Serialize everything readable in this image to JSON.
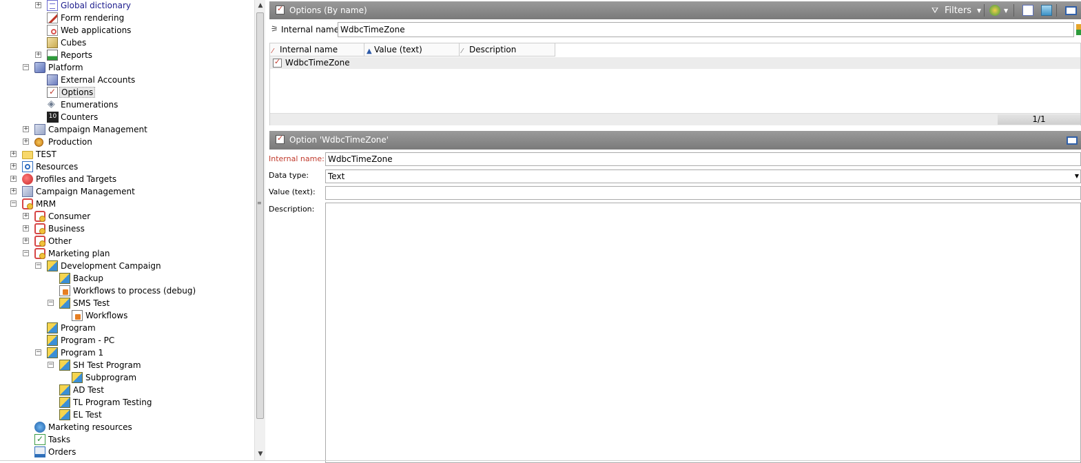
{
  "tree": {
    "items": [
      {
        "label": "Global dictionary",
        "icon": "dictionary-icon",
        "expander": "plus"
      },
      {
        "label": "Form rendering",
        "icon": "form-rendering-icon"
      },
      {
        "label": "Web applications",
        "icon": "web-applications-icon"
      },
      {
        "label": "Cubes",
        "icon": "cube-icon"
      },
      {
        "label": "Reports",
        "icon": "report-icon",
        "expander": "plus"
      },
      {
        "label": "Platform",
        "icon": "platform-icon",
        "expander": "minus"
      },
      {
        "label": "External Accounts",
        "icon": "external-accounts-icon"
      },
      {
        "label": "Options",
        "icon": "options-icon",
        "selected": true
      },
      {
        "label": "Enumerations",
        "icon": "enumerations-icon"
      },
      {
        "label": "Counters",
        "icon": "counters-icon",
        "icon_text": "10"
      },
      {
        "label": "Campaign Management",
        "icon": "campaign-management-icon",
        "expander": "plus"
      },
      {
        "label": "Production",
        "icon": "production-icon",
        "expander": "plus"
      },
      {
        "label": "TEST",
        "icon": "folder-icon",
        "expander": "plus"
      },
      {
        "label": "Resources",
        "icon": "resources-icon",
        "expander": "plus"
      },
      {
        "label": "Profiles and Targets",
        "icon": "profiles-targets-icon",
        "expander": "plus"
      },
      {
        "label": "Campaign Management",
        "icon": "campaign-management-icon",
        "expander": "plus"
      },
      {
        "label": "MRM",
        "icon": "mrm-icon",
        "expander": "minus"
      },
      {
        "label": "Consumer",
        "icon": "mrm-icon",
        "expander": "plus"
      },
      {
        "label": "Business",
        "icon": "mrm-icon",
        "expander": "plus"
      },
      {
        "label": "Other",
        "icon": "mrm-icon",
        "expander": "plus"
      },
      {
        "label": "Marketing plan",
        "icon": "mrm-icon",
        "expander": "minus"
      },
      {
        "label": "Development Campaign",
        "icon": "program-icon",
        "expander": "minus"
      },
      {
        "label": "Backup",
        "icon": "program-icon"
      },
      {
        "label": "Workflows to process (debug)",
        "icon": "workflow-icon"
      },
      {
        "label": "SMS Test",
        "icon": "program-icon",
        "expander": "minus"
      },
      {
        "label": "Workflows",
        "icon": "workflow-icon"
      },
      {
        "label": "Program",
        "icon": "program-icon"
      },
      {
        "label": "Program - PC",
        "icon": "program-icon"
      },
      {
        "label": "Program 1",
        "icon": "program-icon",
        "expander": "minus"
      },
      {
        "label": "SH Test Program",
        "icon": "program-icon",
        "expander": "minus"
      },
      {
        "label": "Subprogram",
        "icon": "program-icon"
      },
      {
        "label": "AD Test",
        "icon": "program-icon"
      },
      {
        "label": "TL Program Testing",
        "icon": "program-icon"
      },
      {
        "label": "EL Test",
        "icon": "program-icon"
      },
      {
        "label": "Marketing resources",
        "icon": "marketing-resources-icon"
      },
      {
        "label": "Tasks",
        "icon": "tasks-icon"
      },
      {
        "label": "Orders",
        "icon": "orders-icon"
      }
    ]
  },
  "list_panel": {
    "title": "Options (By name)",
    "filters_label": "Filters",
    "search_label": "Internal name:",
    "search_value": "WdbcTimeZone",
    "columns": [
      "Internal name",
      "Value (text)",
      "Description"
    ],
    "rows": [
      {
        "name": "WdbcTimeZone"
      }
    ],
    "pager": "1/1"
  },
  "detail_panel": {
    "title": "Option 'WdbcTimeZone'",
    "internal_name_label": "Internal name:",
    "internal_name_value": "WdbcTimeZone",
    "data_type_label": "Data type:",
    "data_type_value": "Text",
    "value_label": "Value (text):",
    "value_value": "",
    "description_label": "Description:",
    "description_value": ""
  },
  "colors": {
    "header_bar": "#8a8a8a",
    "required_label": "#c0392b",
    "link": "#1a1a8c"
  }
}
